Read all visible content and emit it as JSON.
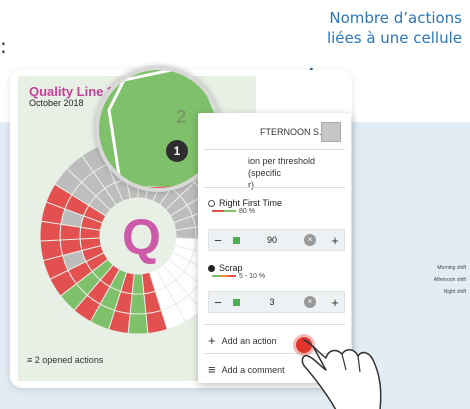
{
  "callout": {
    "line1": "Nombre d’actions",
    "line2": "liées à une cellule"
  },
  "colon": ":",
  "chart": {
    "title": "Quality Line 3",
    "subtitle": "October 2018",
    "center_letter": "Q",
    "legend": [
      "Morning shift",
      "Afternoon shift",
      "Night shift"
    ],
    "opened_actions": "2 opened actions",
    "cell_action_count": "2",
    "cell_badge": "1",
    "colors": {
      "green": "#7fc06a",
      "red": "#e35050",
      "grey": "#bdbdbd",
      "white": "#ffffff",
      "orange": "#f0883a",
      "pink": "#cd5aa8"
    }
  },
  "popover": {
    "header": "FTERNOON S...",
    "threshold_text_1": "ion per threshold (specific",
    "threshold_text_2": "r)",
    "indicators": [
      {
        "name": "Right First Time",
        "range": "80 %",
        "value": "90"
      },
      {
        "name": "Scrap",
        "range": "5 - 10 %",
        "value": "3"
      }
    ],
    "add_action": "Add an action",
    "add_comment": "Add a comment",
    "stepper_minus": "−",
    "stepper_plus": "+",
    "stepper_clear": "×"
  }
}
